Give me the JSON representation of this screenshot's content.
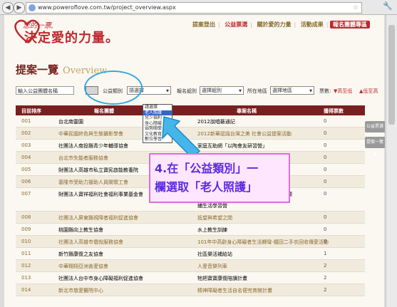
{
  "browser": {
    "url": "www.poweroflove.com.tw/project_overview.aspx",
    "back_glyph": "◀",
    "forward_glyph": "▶",
    "star_glyph": "☆",
    "wrench_glyph": "🔧"
  },
  "site": {
    "logo_small": "您的一票,",
    "logo_text": "決定愛的力量。",
    "nav": [
      "提案登出",
      "公益票選",
      "關於愛的力量",
      "活動成果"
    ],
    "nav_active": "公益票選",
    "nav_red": "報名團體專區"
  },
  "page": {
    "title": "提案一覽",
    "title_en": "Overview"
  },
  "filters": {
    "search_value": "輸入公益團體名稱",
    "category_label": "公益類別",
    "category_value": "請選擇",
    "group_label": "報名組別",
    "group_value": "選擇組別",
    "region_label": "所在地區",
    "region_value": "選擇地區",
    "votes_label": "票數:",
    "sort_high": "▼高至低",
    "sort_low": "▲低至高"
  },
  "category_options": [
    "請選擇",
    "老人照護",
    "兒少福利",
    "身心障礙",
    "弱勢關懷",
    "文化教育",
    "數位學習"
  ],
  "category_selected": "老人照護",
  "table": {
    "headers": [
      "目前排序",
      "報名團體",
      "專案名稱",
      "獲得票數"
    ],
    "rows": [
      {
        "rank": "001",
        "group": "台北南靈園",
        "project": "2012說唱藝通記",
        "votes": "0"
      },
      {
        "rank": "002",
        "group": "中華民國終色與生態攝影學會",
        "project": "2012新華認識台灣之美 社會公益提案活動",
        "votes": "0"
      },
      {
        "rank": "003",
        "group": "社團法人南投縣青少年輔導協會",
        "project": "家庭互助網「以陶會友研習營」",
        "votes": "0"
      },
      {
        "rank": "004",
        "group": "台北市失能者服務協會",
        "project": "",
        "votes": "0"
      },
      {
        "rank": "005",
        "group": "財團法人高雄市私立寶民啟能教養院",
        "project": "",
        "votes": "0"
      },
      {
        "rank": "006",
        "group": "基隆市受助力援助人員關懷工會",
        "project": "",
        "votes": "0"
      },
      {
        "rank": "007",
        "group": "財團法人寶祥福利社會福利事業基金會",
        "project": "鋪生活學習營",
        "project_top": "展日間顧",
        "votes": "0"
      },
      {
        "rank": "008",
        "group": "社團法人屏東縣視障者福利促進協會",
        "project": "抵望與希望之間",
        "votes": "0"
      },
      {
        "rank": "009",
        "group": "桃園縣向上教生協會",
        "project": "水上教生訓練",
        "votes": "0"
      },
      {
        "rank": "010",
        "group": "社團法人高雄市僑悅服務協會",
        "project": "101年中高齡身心障礙者生活轉彎-鐵田二手衣回收傳愛活動",
        "votes": "0"
      },
      {
        "rank": "011",
        "group": "新竹縣康復之友協會",
        "project": "社區樂活補給站",
        "votes": "1"
      },
      {
        "rank": "012",
        "group": "中華翱翔亞洲善愛協會",
        "project": "人愛音樂列車",
        "votes": "2"
      },
      {
        "rank": "013",
        "group": "社團法人台中市身心障礙福利促進協會",
        "project": "牠把寶寶康復陪讀計畫",
        "votes": "2"
      },
      {
        "rank": "014",
        "group": "新北市慈愛醫院中心",
        "project": "精神障礙者生活自名便完育館計畫",
        "votes": "2"
      }
    ]
  },
  "side_tabs": [
    "公益票選▲",
    "提案一覽▲"
  ],
  "callout": {
    "line1": "4.在「公益類別」一",
    "line2": "欄選取「老人照護」"
  },
  "colors": {
    "brand_red": "#c0282f",
    "header_bg": "#7a1f1f",
    "highlight_blue": "#38a8e0",
    "callout_text": "#5b2be0"
  }
}
